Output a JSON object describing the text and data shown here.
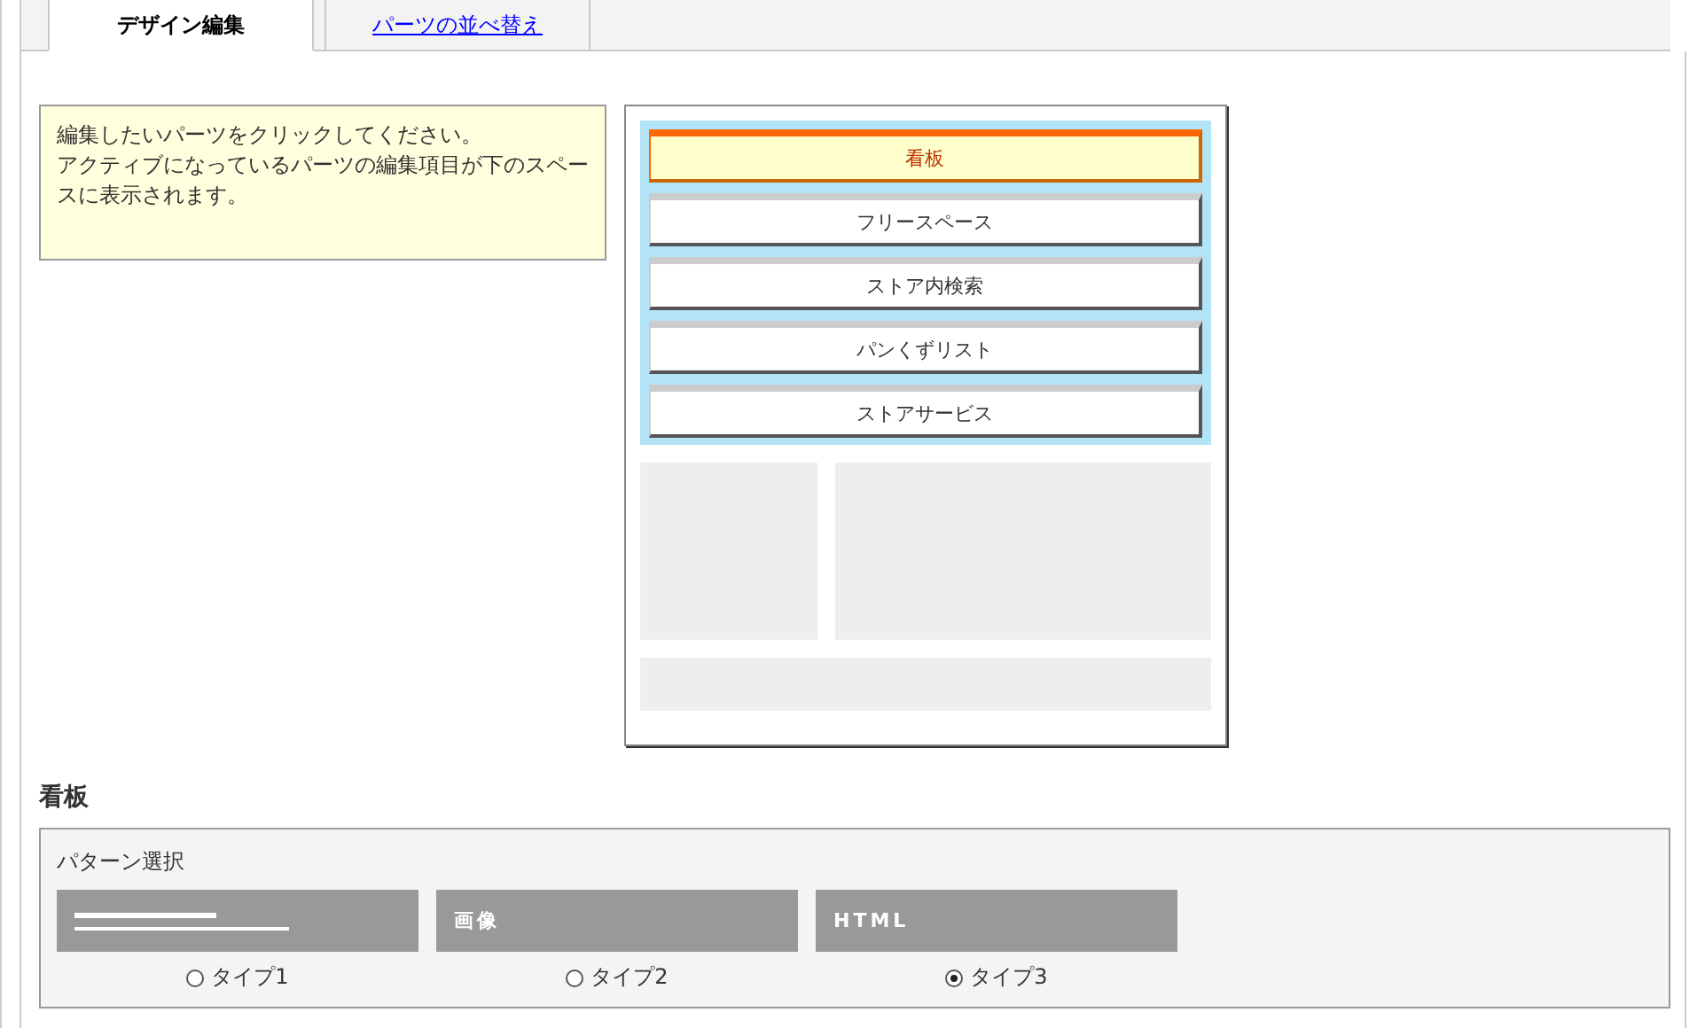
{
  "tabs": [
    {
      "label": "デザイン編集",
      "selected": true
    },
    {
      "label": "パーツの並べ替え",
      "selected": false
    }
  ],
  "hint": [
    "編集したいパーツをクリックしてください。",
    "アクティブになっているパーツの編集項目が下のスペースに表示されます。"
  ],
  "parts": [
    {
      "label": "看板",
      "selected": true
    },
    {
      "label": "フリースペース",
      "selected": false
    },
    {
      "label": "ストア内検索",
      "selected": false
    },
    {
      "label": "パンくずリスト",
      "selected": false
    },
    {
      "label": "ストアサービス",
      "selected": false
    }
  ],
  "section_title": "看板",
  "pattern": {
    "label": "パターン選択",
    "options": [
      {
        "kind": "lines",
        "label": "タイプ1",
        "selected": false
      },
      {
        "kind": "text",
        "preview": "画像",
        "label": "タイプ2",
        "selected": false
      },
      {
        "kind": "text",
        "preview": "HTML",
        "label": "タイプ3",
        "selected": true
      }
    ]
  }
}
